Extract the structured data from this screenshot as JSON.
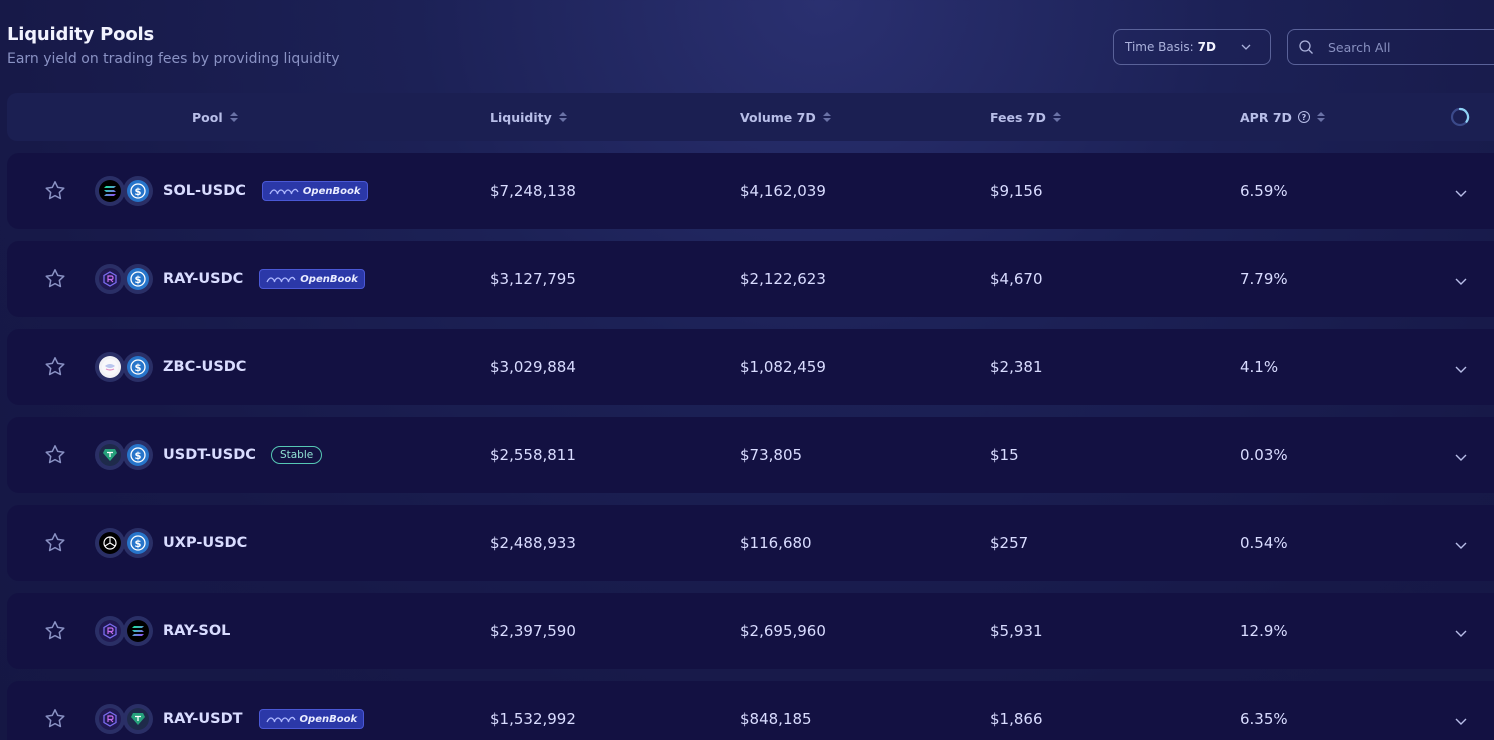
{
  "header": {
    "title": "Liquidity Pools",
    "subtitle": "Earn yield on trading fees by providing liquidity"
  },
  "time_basis": {
    "label": "Time Basis:",
    "value": "7D"
  },
  "search": {
    "placeholder": "Search All"
  },
  "columns": {
    "pool": "Pool",
    "liquidity": "Liquidity",
    "volume": "Volume 7D",
    "fees": "Fees 7D",
    "apr": "APR 7D"
  },
  "colors": {
    "background": "#171948",
    "row_background": "#131142",
    "openbook_badge": "#2b38a8",
    "stable_badge": "#56c7b4",
    "usdc_token": "#2775ca",
    "usdt_token": "#26a17b",
    "ray_token": "#5b4bc4",
    "sol_gradient_start": "#9945ff",
    "sol_gradient_end": "#14f195"
  },
  "pools": [
    {
      "name": "SOL-USDC",
      "badge": "OpenBook",
      "badge_type": "openbook",
      "token_a": "sol",
      "token_b": "usdc",
      "liquidity": "$7,248,138",
      "volume": "$4,162,039",
      "fees": "$9,156",
      "apr": "6.59%"
    },
    {
      "name": "RAY-USDC",
      "badge": "OpenBook",
      "badge_type": "openbook",
      "token_a": "ray",
      "token_b": "usdc",
      "liquidity": "$3,127,795",
      "volume": "$2,122,623",
      "fees": "$4,670",
      "apr": "7.79%"
    },
    {
      "name": "ZBC-USDC",
      "badge": "",
      "badge_type": "",
      "token_a": "zbc",
      "token_b": "usdc",
      "liquidity": "$3,029,884",
      "volume": "$1,082,459",
      "fees": "$2,381",
      "apr": "4.1%"
    },
    {
      "name": "USDT-USDC",
      "badge": "Stable",
      "badge_type": "stable",
      "token_a": "usdt",
      "token_b": "usdc",
      "liquidity": "$2,558,811",
      "volume": "$73,805",
      "fees": "$15",
      "apr": "0.03%"
    },
    {
      "name": "UXP-USDC",
      "badge": "",
      "badge_type": "",
      "token_a": "uxp",
      "token_b": "usdc",
      "liquidity": "$2,488,933",
      "volume": "$116,680",
      "fees": "$257",
      "apr": "0.54%"
    },
    {
      "name": "RAY-SOL",
      "badge": "",
      "badge_type": "",
      "token_a": "ray",
      "token_b": "sol",
      "liquidity": "$2,397,590",
      "volume": "$2,695,960",
      "fees": "$5,931",
      "apr": "12.9%"
    },
    {
      "name": "RAY-USDT",
      "badge": "OpenBook",
      "badge_type": "openbook",
      "token_a": "ray",
      "token_b": "usdt",
      "liquidity": "$1,532,992",
      "volume": "$848,185",
      "fees": "$1,866",
      "apr": "6.35%"
    }
  ]
}
